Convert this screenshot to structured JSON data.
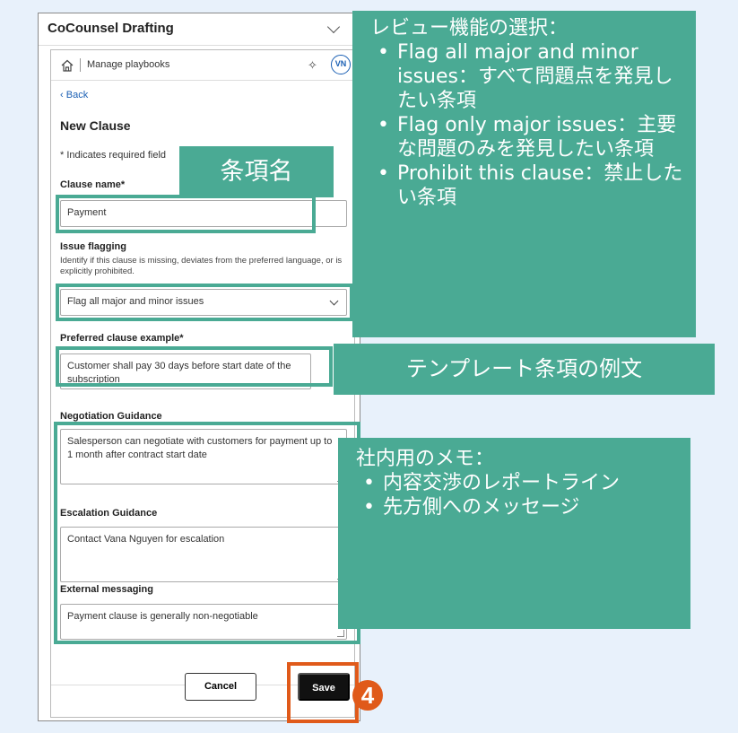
{
  "app": {
    "title": "CoCounsel Drafting"
  },
  "nav": {
    "manage_playbooks": "Manage playbooks",
    "avatar_initials": "VN"
  },
  "back_label": "Back",
  "form": {
    "title": "New Clause",
    "required_note": "* Indicates required field",
    "clause_name": {
      "label": "Clause name*",
      "value": "Payment"
    },
    "issue_flagging": {
      "label": "Issue flagging",
      "description": "Identify if this clause is missing, deviates from the preferred language, or is explicitly prohibited.",
      "selected": "Flag all major and minor issues"
    },
    "preferred_example": {
      "label": "Preferred clause example*",
      "value": "Customer shall pay 30 days before start date of the subscription"
    },
    "negotiation_guidance": {
      "label": "Negotiation Guidance",
      "value": "Salesperson can negotiate with customers for payment up to 1 month after contract start date"
    },
    "escalation_guidance": {
      "label": "Escalation Guidance",
      "value": "Contact Vana Nguyen for escalation"
    },
    "external_messaging": {
      "label": "External messaging",
      "value": "Payment clause is generally non-negotiable"
    }
  },
  "buttons": {
    "cancel": "Cancel",
    "save": "Save"
  },
  "annotations": {
    "review_callout": {
      "title": "レビュー機能の選択：",
      "items": [
        "Flag all major and minor issues：すべて問題点を発見したい条項",
        "Flag only major issues：主要な問題のみを発見したい条項",
        "Prohibit this clause：禁止したい条項"
      ]
    },
    "clause_name_callout": "条項名",
    "template_callout": "テンプレート条項の例文",
    "memo_callout": {
      "title": "社内用のメモ：",
      "items": [
        "内容交渉のレポートライン",
        "先方側へのメッセージ"
      ]
    },
    "step_number": "4"
  },
  "colors": {
    "callout": "#4aaa94",
    "step": "#e05a1a",
    "link": "#1a5fb4"
  }
}
